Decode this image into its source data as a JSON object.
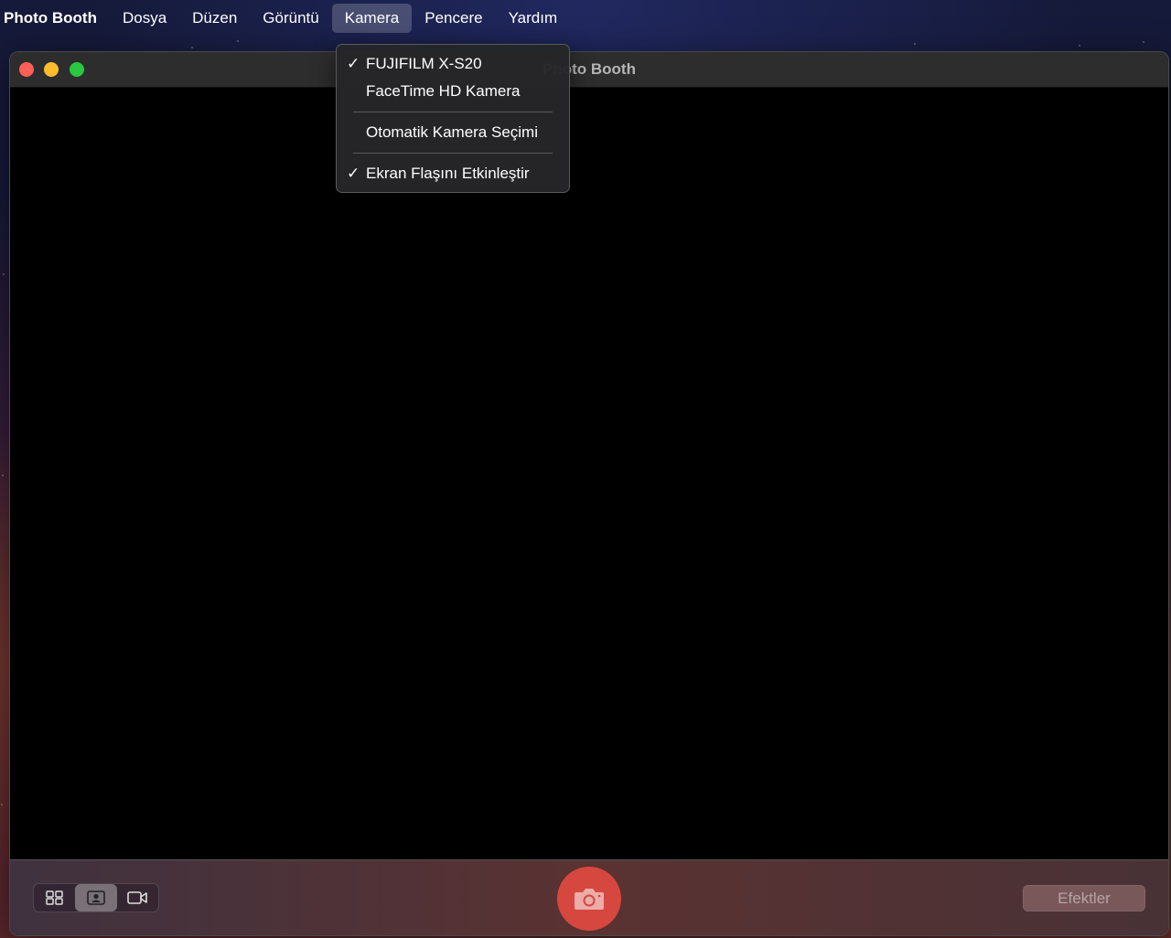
{
  "menubar": {
    "app_name": "Photo Booth",
    "items": [
      {
        "label": "Dosya",
        "active": false
      },
      {
        "label": "Düzen",
        "active": false
      },
      {
        "label": "Görüntü",
        "active": false
      },
      {
        "label": "Kamera",
        "active": true
      },
      {
        "label": "Pencere",
        "active": false
      },
      {
        "label": "Yardım",
        "active": false
      }
    ]
  },
  "window": {
    "title": "Photo Booth",
    "title_visible": "to Booth"
  },
  "camera_menu": {
    "items": [
      {
        "label": "FUJIFILM X-S20",
        "checked": true
      },
      {
        "label": "FaceTime HD Kamera",
        "checked": false
      },
      {
        "label": "Otomatik Kamera Seçimi",
        "checked": false
      },
      {
        "label": "Ekran Flaşını Etkinleştir",
        "checked": true
      }
    ],
    "check_mark": "✓"
  },
  "toolbar": {
    "effects_label": "Efektler",
    "view_modes": [
      "grid-view-icon",
      "single-photo-icon",
      "video-icon"
    ],
    "selected_view": "single-photo-icon"
  },
  "colors": {
    "shutter": "#d6473f",
    "close": "#ff5f57",
    "minimize": "#febc2e",
    "zoom": "#28c840"
  }
}
